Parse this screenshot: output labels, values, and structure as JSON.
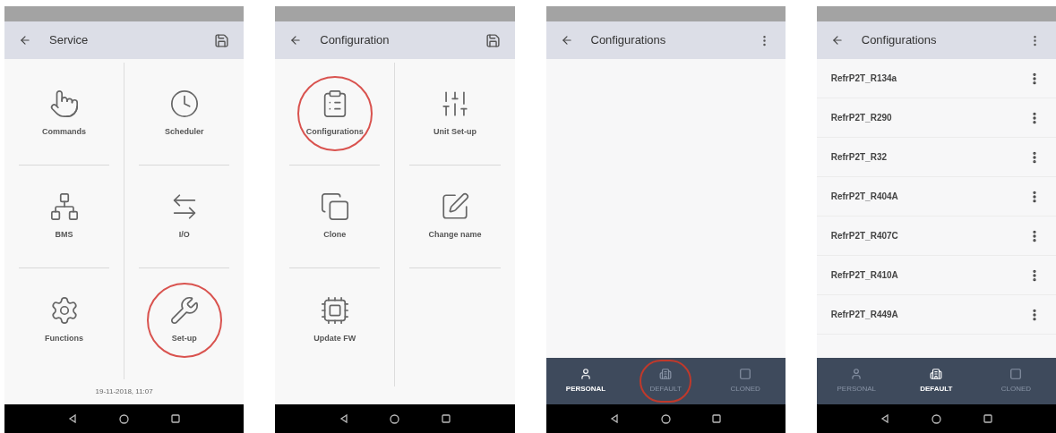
{
  "screens": [
    {
      "kind": "grid",
      "title": "Service",
      "tiles": [
        {
          "label": "Commands",
          "highlighted": false
        },
        {
          "label": "Scheduler",
          "highlighted": false
        },
        {
          "label": "BMS",
          "highlighted": false
        },
        {
          "label": "I/O",
          "highlighted": false
        },
        {
          "label": "Functions",
          "highlighted": false
        },
        {
          "label": "Set-up",
          "highlighted": true
        }
      ],
      "footer": "19-11-2018, 11:07"
    },
    {
      "kind": "grid",
      "title": "Configuration",
      "tiles": [
        {
          "label": "Configurations",
          "highlighted": true
        },
        {
          "label": "Unit Set-up",
          "highlighted": false
        },
        {
          "label": "Clone",
          "highlighted": false
        },
        {
          "label": "Change name",
          "highlighted": false
        },
        {
          "label": "Update FW",
          "highlighted": false
        }
      ]
    },
    {
      "kind": "list",
      "title": "Configurations",
      "tabs": [
        {
          "label": "PERSONAL",
          "selected": true,
          "highlighted": false
        },
        {
          "label": "DEFAULT",
          "selected": false,
          "highlighted": true
        },
        {
          "label": "CLONED",
          "selected": false,
          "highlighted": false
        }
      ]
    },
    {
      "kind": "list",
      "title": "Configurations",
      "items": [
        "RefrP2T_R134a",
        "RefrP2T_R290",
        "RefrP2T_R32",
        "RefrP2T_R404A",
        "RefrP2T_R407C",
        "RefrP2T_R410A",
        "RefrP2T_R449A"
      ],
      "tabs": [
        {
          "label": "PERSONAL",
          "selected": false,
          "highlighted": false
        },
        {
          "label": "DEFAULT",
          "selected": true,
          "highlighted": false
        },
        {
          "label": "CLONED",
          "selected": false,
          "highlighted": false
        }
      ]
    }
  ]
}
